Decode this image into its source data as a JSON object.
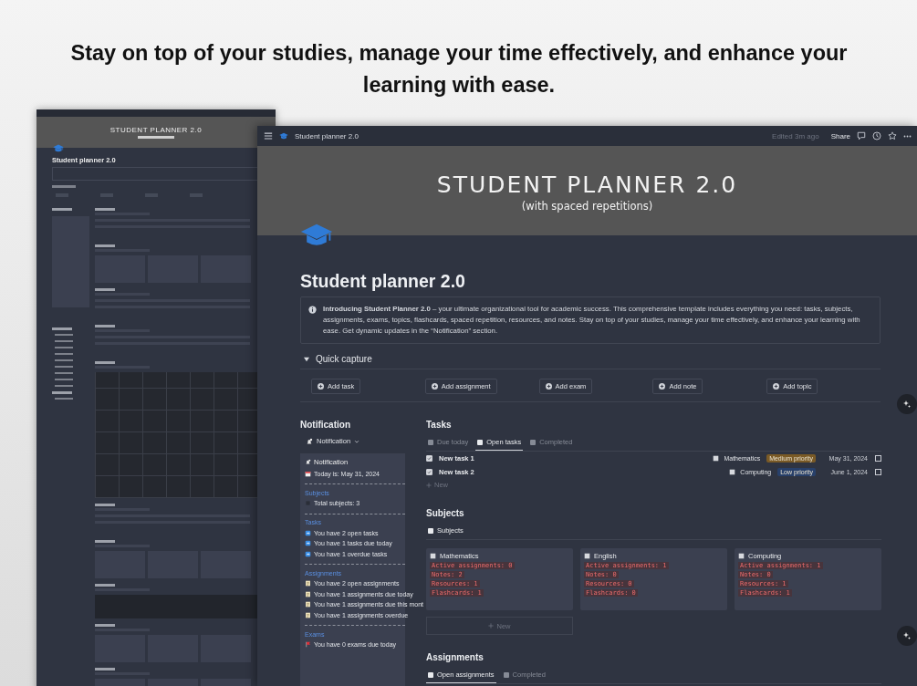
{
  "headline": "Stay on top of your studies, manage your time effectively, and enhance your learning with ease.",
  "preview": {
    "cover_title": "STUDENT PLANNER 2.0",
    "page_title": "Student planner 2.0",
    "sections": [
      {
        "kind": "list"
      },
      {
        "kind": "cards"
      },
      {
        "kind": "list"
      },
      {
        "kind": "list"
      },
      {
        "kind": "calendar"
      },
      {
        "kind": "list"
      },
      {
        "kind": "cards"
      },
      {
        "kind": "table"
      },
      {
        "kind": "cards"
      },
      {
        "kind": "cards"
      }
    ]
  },
  "window": {
    "breadcrumb": "Student planner 2.0",
    "edited": "Edited 3m ago",
    "share": "Share",
    "cover_title": "STUDENT PLANNER 2.0",
    "cover_subtitle": "(with spaced repetitions)",
    "page_title": "Student planner 2.0",
    "callout": "**Introducing Student Planner 2.0** – your ultimate organizational tool for academic success. This comprehensive template includes everything you need: tasks, subjects, assignments, exams, topics, flashcards, spaced repetition, resources, and notes. Stay on top of your studies, manage your time effectively, and enhance your learning with ease. Get dynamic updates in the “Notification” section.",
    "quick_capture": {
      "label": "Quick capture",
      "expanded": true,
      "buttons": [
        "Add task",
        "Add assignment",
        "Add exam",
        "Add note",
        "Add topic"
      ]
    },
    "notification": {
      "heading": "Notification",
      "view_button": "Notification",
      "card_title": "Notification",
      "today": "Today is: May 31, 2024",
      "groups": [
        {
          "label": "Subjects",
          "items": [
            {
              "text": "Total subjects: 3",
              "kind": "dot"
            }
          ]
        },
        {
          "label": "Tasks",
          "items": [
            {
              "text": "You have 2 open tasks",
              "kind": "task"
            },
            {
              "text": "You have 1 tasks due today",
              "kind": "task"
            },
            {
              "text": "You have 1 overdue tasks",
              "kind": "task"
            }
          ]
        },
        {
          "label": "Assignments",
          "items": [
            {
              "text": "You have 2 open assignments",
              "kind": "assignment"
            },
            {
              "text": "You have 1 assignments due today",
              "kind": "assignment"
            },
            {
              "text": "You have 1 assignments due this mont",
              "kind": "assignment"
            },
            {
              "text": "You have 1 assignments overdue",
              "kind": "assignment"
            }
          ]
        },
        {
          "label": "Exams",
          "items": [
            {
              "text": "You have 0 exams due today",
              "kind": "exam"
            }
          ]
        }
      ]
    },
    "tasks": {
      "heading": "Tasks",
      "tabs": [
        {
          "label": "Due today",
          "selected": false
        },
        {
          "label": "Open tasks",
          "selected": true
        },
        {
          "label": "Completed",
          "selected": false
        }
      ],
      "rows": [
        {
          "name": "New task 1",
          "done": true,
          "subject": "Mathematics",
          "priority": "Medium priority",
          "color": "#7a5a26",
          "date": "May 31, 2024",
          "checked": false
        },
        {
          "name": "New task 2",
          "done": true,
          "subject": "Computing",
          "priority": "Low priority",
          "color": "#28406a",
          "date": "June 1, 2024",
          "checked": false
        }
      ],
      "new": "New"
    },
    "subjects": {
      "heading": "Subjects",
      "view": "Subjects",
      "cards": [
        {
          "name": "Mathematics",
          "stats": [
            "Active assignments: 0",
            "Notes: 2",
            "Resources: 1",
            "Flashcards: 1"
          ]
        },
        {
          "name": "English",
          "stats": [
            "Active assignments: 1",
            "Notes: 0",
            "Resources: 0",
            "Flashcards: 0"
          ]
        },
        {
          "name": "Computing",
          "stats": [
            "Active assignments: 1",
            "Notes: 0",
            "Resources: 1",
            "Flashcards: 1"
          ]
        }
      ],
      "new": "New"
    },
    "assignments": {
      "heading": "Assignments",
      "tabs": [
        {
          "label": "Open assignments",
          "selected": true
        },
        {
          "label": "Completed",
          "selected": false
        }
      ]
    }
  }
}
